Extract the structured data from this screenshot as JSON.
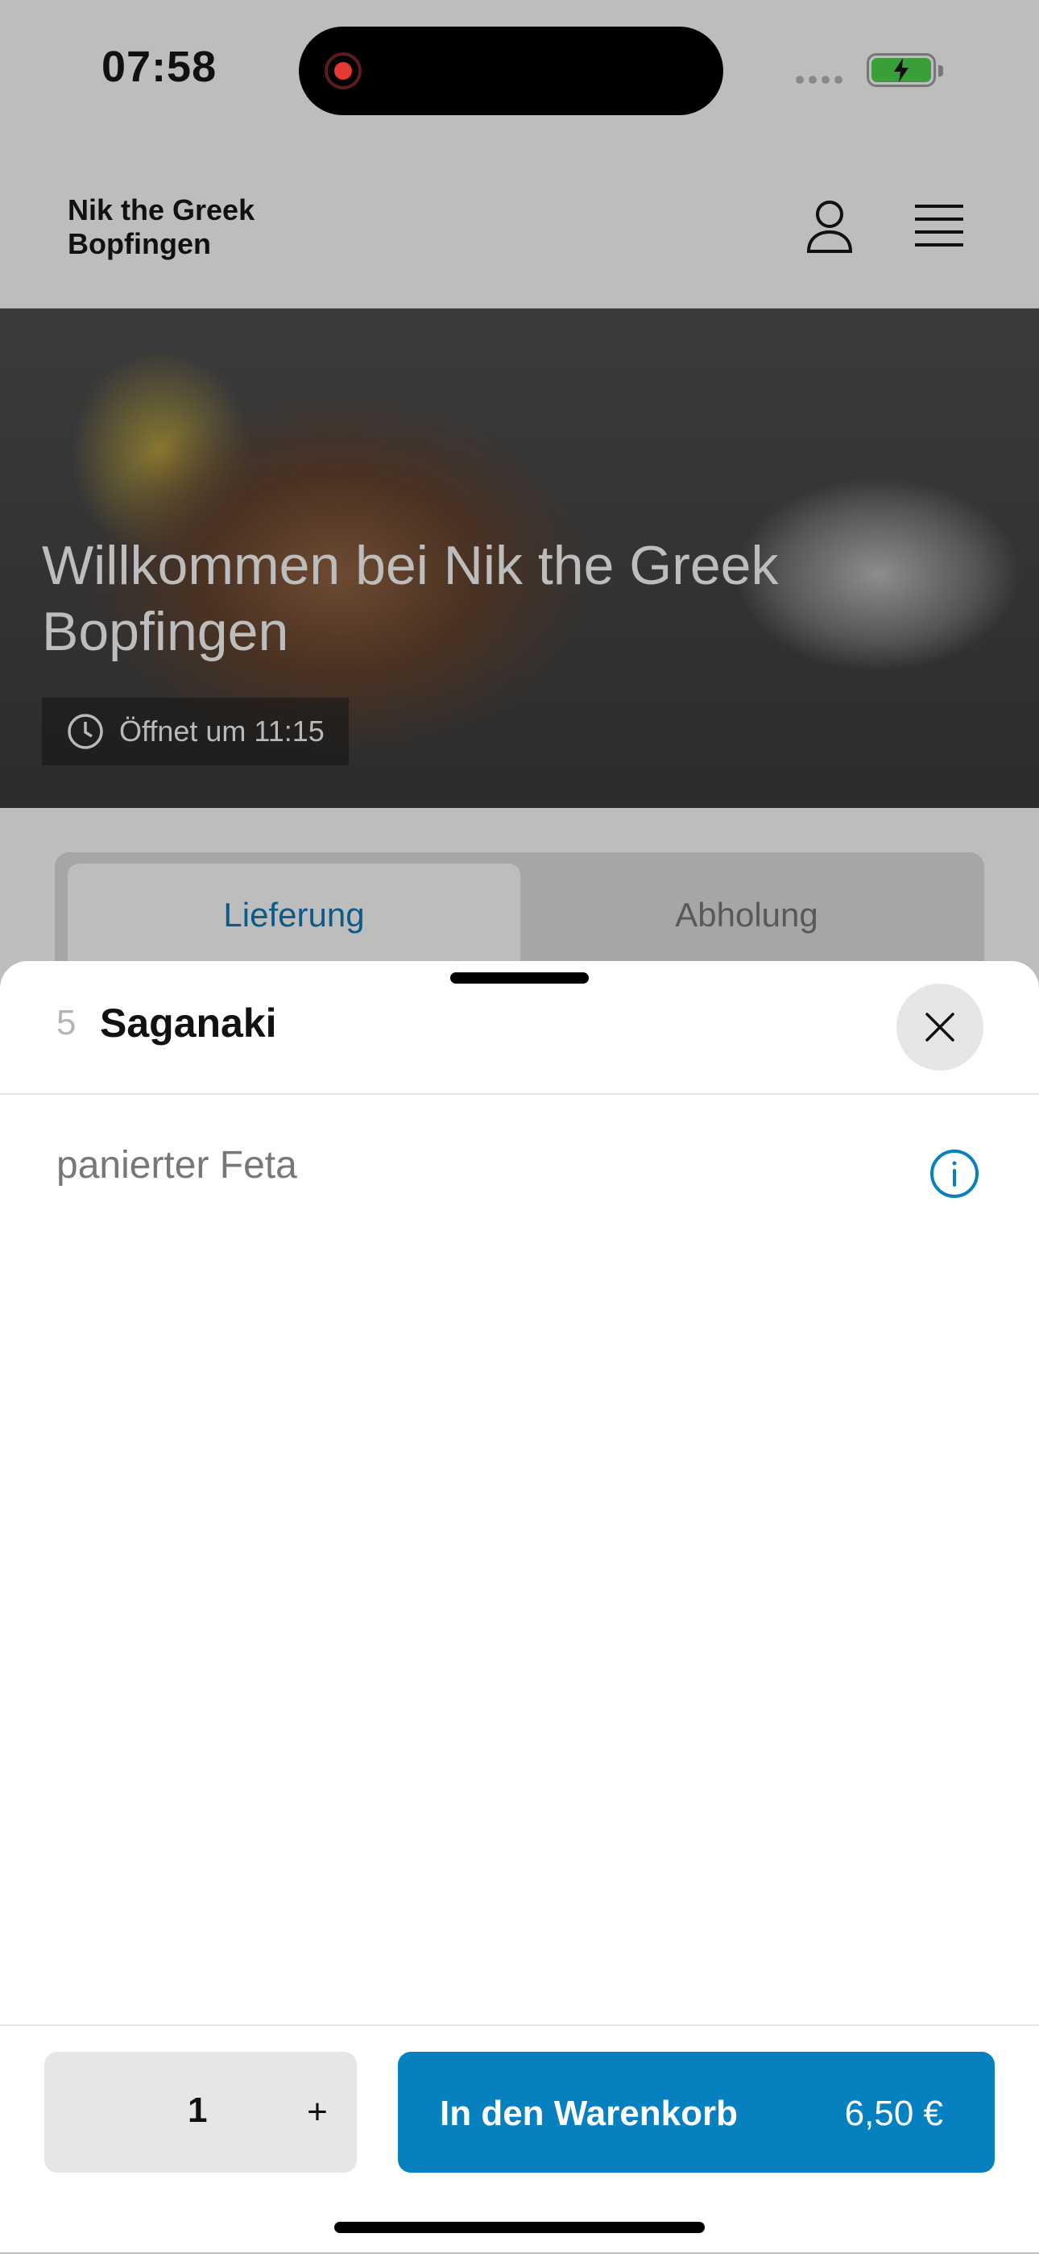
{
  "status_bar": {
    "time": "07:58"
  },
  "header": {
    "restaurant_name": "Nik the Greek Bopfingen"
  },
  "hero": {
    "title": "Willkommen bei Nik the Greek Bopfingen",
    "opening_info": "Öffnet um 11:15"
  },
  "order_tabs": {
    "delivery": "Lieferung",
    "pickup": "Abholung",
    "selected": "Lieferung"
  },
  "item_sheet": {
    "item_number": "5",
    "item_name": "Saganaki",
    "description": "panierter Feta",
    "quantity": "1",
    "plus_label": "+",
    "add_to_cart_label": "In den Warenkorb",
    "price": "6,50 €"
  },
  "colors": {
    "accent": "#0780BF",
    "active_tab_text": "#0C5A87"
  }
}
